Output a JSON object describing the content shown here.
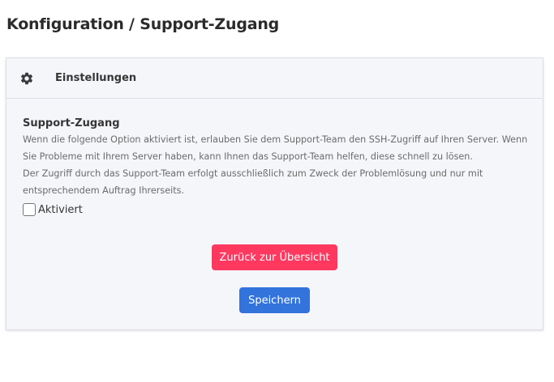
{
  "page": {
    "title": "Konfiguration / Support-Zugang"
  },
  "card": {
    "header": {
      "icon": "gear-icon",
      "title": "Einstellungen"
    },
    "section": {
      "title": "Support-Zugang",
      "description_line1": "Wenn die folgende Option aktiviert ist, erlauben Sie dem Support-Team den SSH-Zugriff auf Ihren Server. Wenn Sie Probleme mit Ihrem Server haben, kann Ihnen das Support-Team helfen, diese schnell zu lösen.",
      "description_line2": "Der Zugriff durch das Support-Team erfolgt ausschließlich zum Zweck der Problemlösung und nur mit entsprechendem Auftrag Ihrerseits."
    },
    "checkbox": {
      "label": "Aktiviert",
      "checked": false
    },
    "buttons": {
      "back_label": "Zurück zur Übersicht",
      "save_label": "Speichern"
    }
  },
  "colors": {
    "danger": "#ff3860",
    "primary": "#3273dc",
    "card_background": "#f5f6fa"
  }
}
